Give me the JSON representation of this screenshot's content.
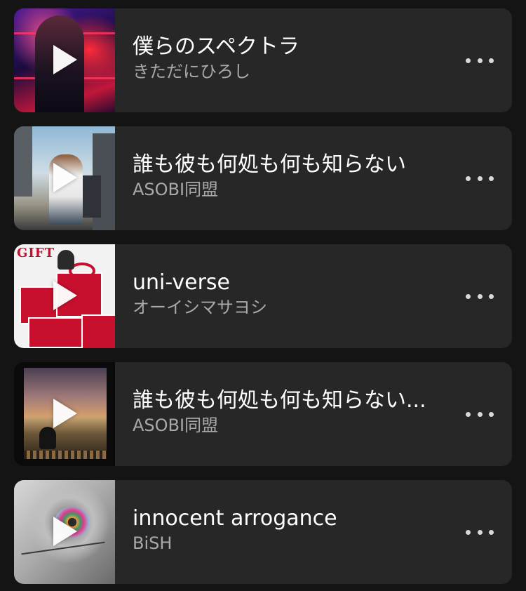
{
  "tracks": [
    {
      "title": "僕らのスペクトラ",
      "artist": "きただにひろし"
    },
    {
      "title": "誰も彼も何処も何も知らない",
      "artist": "ASOBI同盟"
    },
    {
      "title": "uni-verse",
      "artist": "オーイシマサヨシ",
      "artwork_text": "GIFT"
    },
    {
      "title": "誰も彼も何処も何も知らない...",
      "artist": "ASOBI同盟"
    },
    {
      "title": "innocent arrogance",
      "artist": "BiSH"
    }
  ],
  "icons": {
    "play": "play-icon",
    "more": "more-options-icon"
  },
  "colors": {
    "background": "#141414",
    "card": "#272727",
    "title": "#ffffff",
    "artist": "#a9a9a9"
  }
}
